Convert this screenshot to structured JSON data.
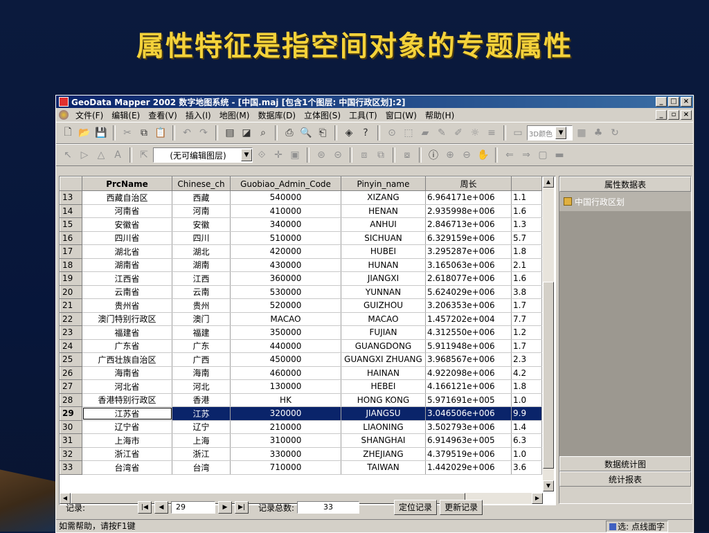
{
  "slide": {
    "title": "属性特征是指空间对象的专题属性"
  },
  "window": {
    "title": "GeoData Mapper 2002 数字地图系统 - [中国.maj [包含1个图层: 中国行政区划]:2]",
    "buttons": {
      "min": "_",
      "max": "□",
      "close": "×",
      "restore": "▫"
    }
  },
  "menu": [
    "文件(F)",
    "编辑(E)",
    "查看(V)",
    "插入(I)",
    "地图(M)",
    "数据库(D)",
    "立体图(S)",
    "工具(T)",
    "窗口(W)",
    "帮助(H)"
  ],
  "toolbar1": {
    "icons": [
      "new-icon",
      "open-icon",
      "save-icon",
      "cut-icon",
      "copy-icon",
      "paste-icon",
      "undo-icon",
      "redo-icon",
      "map-icon",
      "chart-icon",
      "zoom-icon",
      "print-icon",
      "preview-icon",
      "printer-icon",
      "tool-icon",
      "help-icon",
      "globe-icon",
      "cube-icon",
      "solid-icon",
      "pen-icon",
      "brush-icon",
      "sun-icon",
      "list-icon",
      "layer-icon",
      "palette-icon",
      "tool2-icon",
      "refresh-icon"
    ],
    "combo_3d": "3D颜色"
  },
  "toolbar2": {
    "edit_layer": "(无可编辑图层)"
  },
  "grid": {
    "columns": [
      "PrcName",
      "Chinese_ch",
      "Guobiao_Admin_Code",
      "Pinyin_name",
      "周长",
      ""
    ],
    "rows": [
      [
        "13",
        "西藏自治区",
        "西藏",
        "540000",
        "XIZANG",
        "6.964171e+006",
        "1.1"
      ],
      [
        "14",
        "河南省",
        "河南",
        "410000",
        "HENAN",
        "2.935998e+006",
        "1.6"
      ],
      [
        "15",
        "安徽省",
        "安徽",
        "340000",
        "ANHUI",
        "2.846713e+006",
        "1.3"
      ],
      [
        "16",
        "四川省",
        "四川",
        "510000",
        "SICHUAN",
        "6.329159e+006",
        "5.7"
      ],
      [
        "17",
        "湖北省",
        "湖北",
        "420000",
        "HUBEI",
        "3.295287e+006",
        "1.8"
      ],
      [
        "18",
        "湖南省",
        "湖南",
        "430000",
        "HUNAN",
        "3.165063e+006",
        "2.1"
      ],
      [
        "19",
        "江西省",
        "江西",
        "360000",
        "JIANGXI",
        "2.618077e+006",
        "1.6"
      ],
      [
        "20",
        "云南省",
        "云南",
        "530000",
        "YUNNAN",
        "5.624029e+006",
        "3.8"
      ],
      [
        "21",
        "贵州省",
        "贵州",
        "520000",
        "GUIZHOU",
        "3.206353e+006",
        "1.7"
      ],
      [
        "22",
        "澳门特别行政区",
        "澳门",
        "MACAO",
        "MACAO",
        "1.457202e+004",
        "7.7"
      ],
      [
        "23",
        "福建省",
        "福建",
        "350000",
        "FUJIAN",
        "4.312550e+006",
        "1.2"
      ],
      [
        "24",
        "广东省",
        "广东",
        "440000",
        "GUANGDONG",
        "5.911948e+006",
        "1.7"
      ],
      [
        "25",
        "广西壮族自治区",
        "广西",
        "450000",
        "GUANGXI ZHUANG",
        "3.968567e+006",
        "2.3"
      ],
      [
        "26",
        "海南省",
        "海南",
        "460000",
        "HAINAN",
        "4.922098e+006",
        "4.2"
      ],
      [
        "27",
        "河北省",
        "河北",
        "130000",
        "HEBEI",
        "4.166121e+006",
        "1.8"
      ],
      [
        "28",
        "香港特别行政区",
        "香港",
        "HK",
        "HONG KONG",
        "5.971691e+005",
        "1.0"
      ],
      [
        "29",
        "江苏省",
        "江苏",
        "320000",
        "JIANGSU",
        "3.046506e+006",
        "9.9"
      ],
      [
        "30",
        "辽宁省",
        "辽宁",
        "210000",
        "LIAONING",
        "3.502793e+006",
        "1.4"
      ],
      [
        "31",
        "上海市",
        "上海",
        "310000",
        "SHANGHAI",
        "6.914963e+005",
        "6.3"
      ],
      [
        "32",
        "浙江省",
        "浙江",
        "330000",
        "ZHEJIANG",
        "4.379519e+006",
        "1.0"
      ],
      [
        "33",
        "台湾省",
        "台湾",
        "710000",
        "TAIWAN",
        "1.442029e+006",
        "3.6"
      ]
    ],
    "selected_row": "29"
  },
  "panel": {
    "header": "属性数据表",
    "tree_item": "中国行政区划",
    "stat_chart": "数据统计图",
    "stat_report": "统计报表"
  },
  "nav": {
    "record_label": "记录:",
    "current": "29",
    "total_label": "记录总数:",
    "total": "33",
    "locate": "定位记录",
    "update": "更新记录"
  },
  "status": {
    "help": "如需帮助，请按F1键",
    "mode": "选: 点线面字"
  }
}
